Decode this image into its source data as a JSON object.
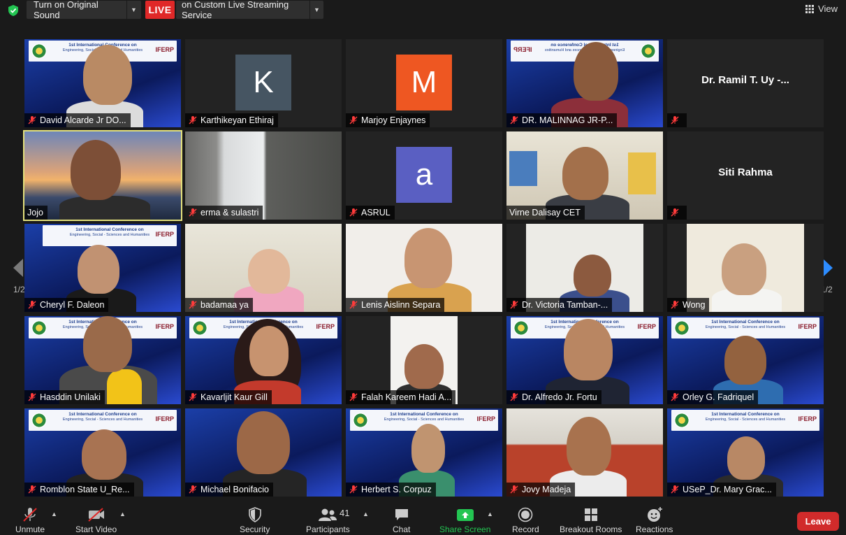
{
  "topbar": {
    "sound_label": "Turn on Original Sound",
    "live_label": "LIVE",
    "stream_label": "on Custom Live Streaming Service",
    "view_label": "View"
  },
  "tiles": [
    {
      "name": "David Alcarde Jr DO..."
    },
    {
      "name": "Karthikeyan Ethiraj",
      "initial": "K",
      "color": "#465562"
    },
    {
      "name": "Marjoy Enjaynes",
      "initial": "M",
      "color": "#ee5722"
    },
    {
      "name": "DR. MALINNAG JR-P..."
    },
    {
      "name": "",
      "title": "Dr. Ramil T. Uy -..."
    },
    {
      "name": "Jojo"
    },
    {
      "name": "erma & sulastri"
    },
    {
      "name": "ASRUL",
      "initial": "a",
      "color": "#5a5fc2"
    },
    {
      "name": "Virne Dalisay CET"
    },
    {
      "name": "",
      "title": "Siti Rahma"
    },
    {
      "name": "Cheryl F. Daleon"
    },
    {
      "name": "badamaa ya"
    },
    {
      "name": "Lenis Aislinn Separa"
    },
    {
      "name": "Dr. Victoria Tamban-..."
    },
    {
      "name": "Wong"
    },
    {
      "name": "Hasddin Unilaki"
    },
    {
      "name": "Kavarljit Kaur Gill"
    },
    {
      "name": "Falah Kareem Hadi A..."
    },
    {
      "name": "Dr. Alfredo Jr. Fortu"
    },
    {
      "name": "Orley G. Fadriquel"
    },
    {
      "name": "Romblon State U_Re..."
    },
    {
      "name": "Michael Bonifacio"
    },
    {
      "name": "Herbert S. Corpuz"
    },
    {
      "name": "Jovy Madeja"
    },
    {
      "name": "USeP_Dr. Mary Grac..."
    }
  ],
  "banner": {
    "line1": "1st International Conference on",
    "line2": "Engineering, Social - Sciences and Humanities",
    "logo_text": "IFERP"
  },
  "pagination": {
    "left": "1/2",
    "right": "1/2"
  },
  "toolbar": {
    "unmute": "Unmute",
    "start_video": "Start Video",
    "security": "Security",
    "participants": "Participants",
    "participants_count": "41",
    "chat": "Chat",
    "share_screen": "Share Screen",
    "record": "Record",
    "breakout_rooms": "Breakout Rooms",
    "reactions": "Reactions",
    "leave": "Leave"
  },
  "colors": {
    "live": "#e02828",
    "share": "#23c552",
    "leave": "#d12b2b",
    "active_speaker": "#e4e17c"
  }
}
